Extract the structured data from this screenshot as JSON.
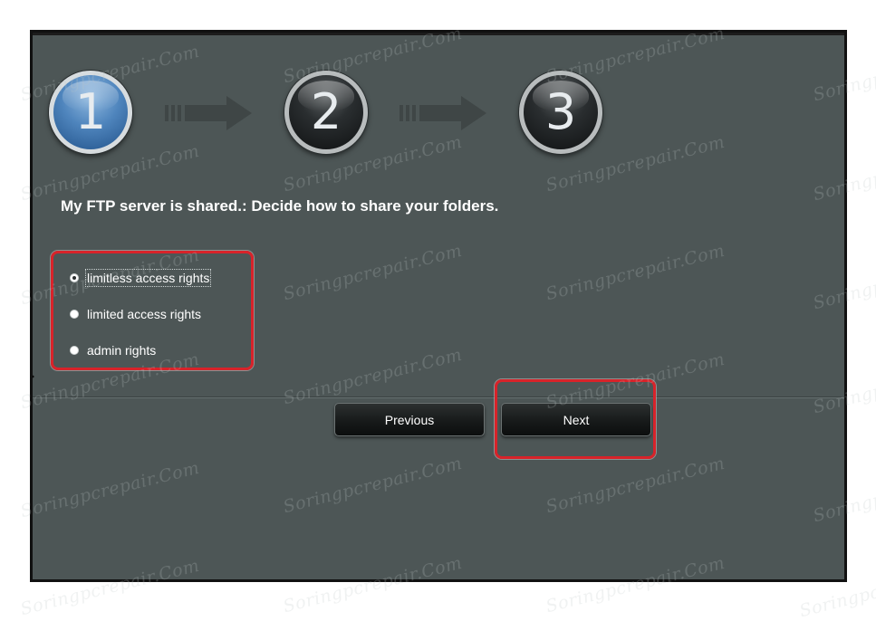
{
  "wizard": {
    "steps": [
      {
        "number": "1",
        "state": "active"
      },
      {
        "number": "2",
        "state": "inactive"
      },
      {
        "number": "3",
        "state": "inactive"
      }
    ],
    "title": "My FTP server is shared.: Decide how to share your folders.",
    "options": [
      {
        "label": "limitless access rights",
        "checked": true
      },
      {
        "label": "limited access rights",
        "checked": false
      },
      {
        "label": "admin rights",
        "checked": false
      }
    ],
    "buttons": {
      "previous_label": "Previous",
      "next_label": "Next"
    }
  },
  "watermark_text": "Soringpcrepair.Com",
  "colors": {
    "panel_background": "#4d5656",
    "highlight_red": "#d8232a",
    "active_step_blue": "#4f85bd",
    "text": "#ffffff"
  },
  "icons": [
    "step-arrow-icon",
    "radio-button-icon"
  ]
}
